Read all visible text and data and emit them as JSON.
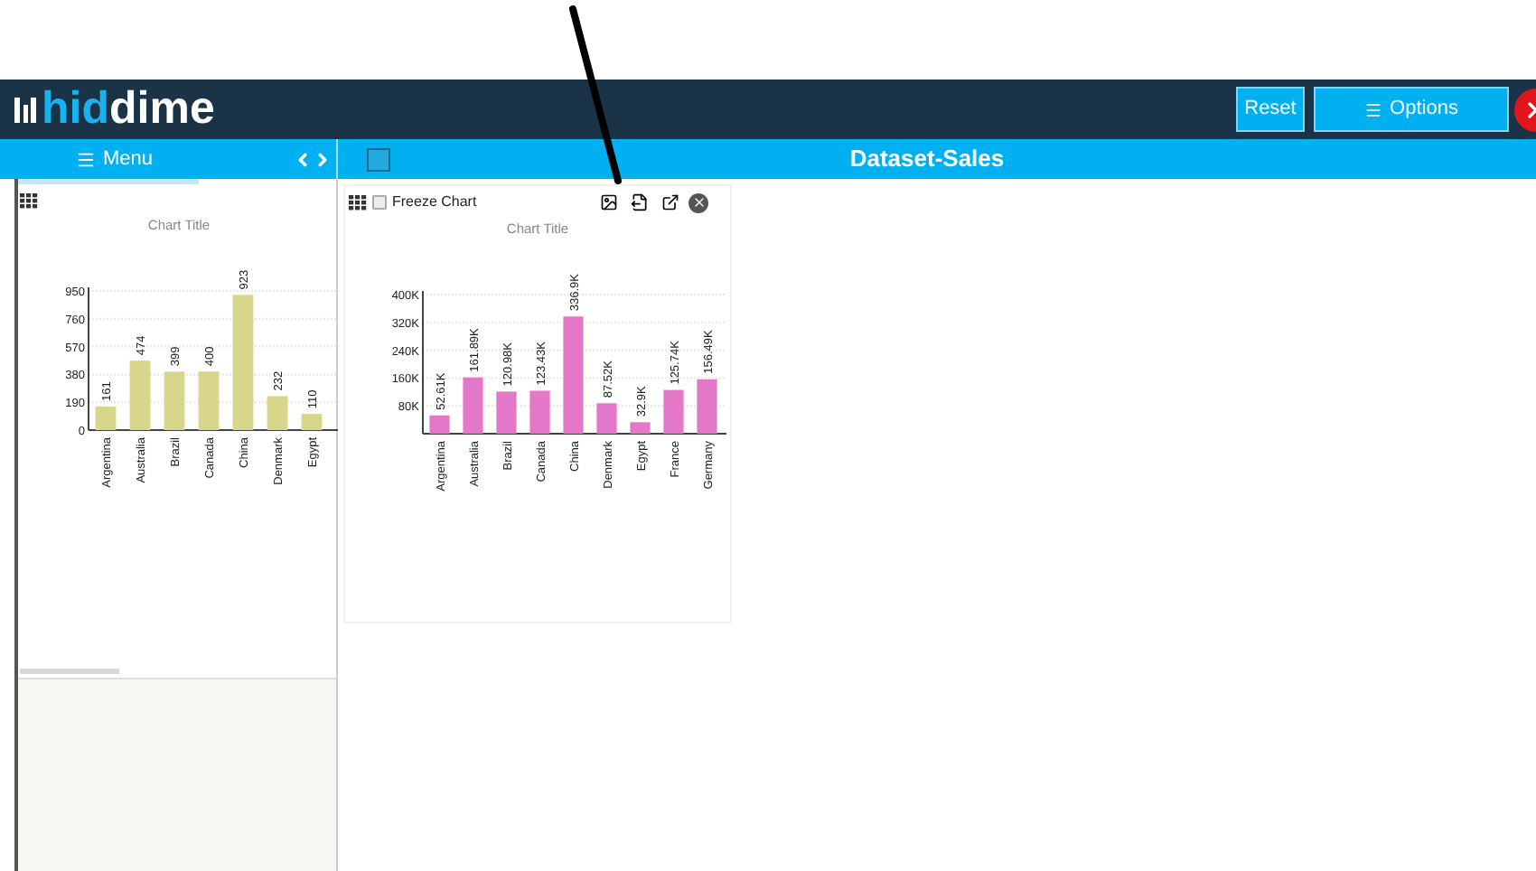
{
  "header": {
    "logo": {
      "part_1": "hid",
      "part_2": "dime"
    },
    "buttons": [
      {
        "label": "Reset",
        "kind": "text"
      },
      {
        "label": "Options",
        "kind": "menu"
      }
    ]
  },
  "menu_bar": {
    "label": "Menu"
  },
  "dataset_title": "Dataset-Sales",
  "left_panel": {
    "chart_data": {
      "type": "bar",
      "title": "Chart Title",
      "categories": [
        "Argentina",
        "Australia",
        "Brazil",
        "Canada",
        "China",
        "Denmark",
        "Egypt"
      ],
      "values": [
        161,
        474,
        399,
        400,
        923,
        232,
        110
      ],
      "grid": true,
      "ylim": [
        0,
        950
      ],
      "yticks": [
        0,
        190,
        380,
        570,
        760,
        950
      ],
      "data_labels": true
    }
  },
  "chart_card": {
    "freeze_chart": {
      "label": "Freeze Chart",
      "checked": false
    },
    "chart_data": {
      "type": "bar",
      "title": "Chart Title",
      "categories": [
        "Argentina",
        "Australia",
        "Brazil",
        "Canada",
        "China",
        "Denmark",
        "Egypt",
        "France",
        "Germany"
      ],
      "values": [
        52610,
        161890,
        120980,
        123430,
        336900,
        87520,
        32900,
        125740,
        156490
      ],
      "grid": true,
      "ylim": [
        0,
        400000
      ],
      "yticks": [
        {
          "value": 80000,
          "label": "80K"
        },
        {
          "value": 160000,
          "label": "160K"
        },
        {
          "value": 240000,
          "label": "240K"
        },
        {
          "value": 320000,
          "label": "320K"
        },
        {
          "value": 400000,
          "label": "400K"
        }
      ],
      "value_labels": [
        "52.61K",
        "161.89K",
        "120.98K",
        "123.43K",
        "336.9K",
        "87.52K",
        "32.9K",
        "125.74K",
        "156.49K"
      ]
    }
  }
}
